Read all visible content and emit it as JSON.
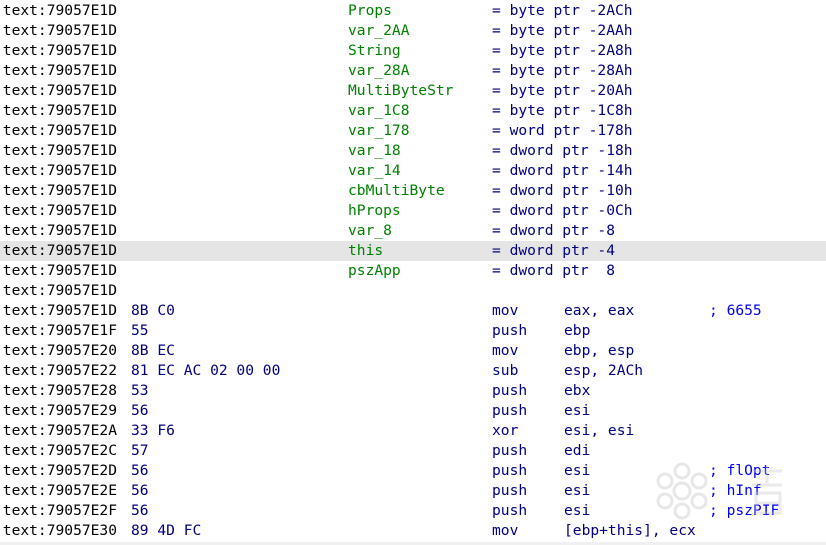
{
  "disasm": {
    "lines": [
      {
        "addr": ".text:79057E1D",
        "bytes": "",
        "name": "Props",
        "mnem": "= byte ptr -2ACh",
        "ops": "",
        "comment": ""
      },
      {
        "addr": ".text:79057E1D",
        "bytes": "",
        "name": "var_2AA",
        "mnem": "= byte ptr -2AAh",
        "ops": "",
        "comment": ""
      },
      {
        "addr": ".text:79057E1D",
        "bytes": "",
        "name": "String",
        "mnem": "= byte ptr -2A8h",
        "ops": "",
        "comment": ""
      },
      {
        "addr": ".text:79057E1D",
        "bytes": "",
        "name": "var_28A",
        "mnem": "= byte ptr -28Ah",
        "ops": "",
        "comment": ""
      },
      {
        "addr": ".text:79057E1D",
        "bytes": "",
        "name": "MultiByteStr",
        "mnem": "= byte ptr -20Ah",
        "ops": "",
        "comment": ""
      },
      {
        "addr": ".text:79057E1D",
        "bytes": "",
        "name": "var_1C8",
        "mnem": "= byte ptr -1C8h",
        "ops": "",
        "comment": ""
      },
      {
        "addr": ".text:79057E1D",
        "bytes": "",
        "name": "var_178",
        "mnem": "= word ptr -178h",
        "ops": "",
        "comment": ""
      },
      {
        "addr": ".text:79057E1D",
        "bytes": "",
        "name": "var_18",
        "mnem": "= dword ptr -18h",
        "ops": "",
        "comment": ""
      },
      {
        "addr": ".text:79057E1D",
        "bytes": "",
        "name": "var_14",
        "mnem": "= dword ptr -14h",
        "ops": "",
        "comment": ""
      },
      {
        "addr": ".text:79057E1D",
        "bytes": "",
        "name": "cbMultiByte",
        "mnem": "= dword ptr -10h",
        "ops": "",
        "comment": ""
      },
      {
        "addr": ".text:79057E1D",
        "bytes": "",
        "name": "hProps",
        "mnem": "= dword ptr -0Ch",
        "ops": "",
        "comment": ""
      },
      {
        "addr": ".text:79057E1D",
        "bytes": "",
        "name": "var_8",
        "mnem": "= dword ptr -8",
        "ops": "",
        "comment": ""
      },
      {
        "addr": ".text:79057E1D",
        "bytes": "",
        "name": "this",
        "mnem": "= dword ptr -4",
        "ops": "",
        "comment": "",
        "highlight": true
      },
      {
        "addr": ".text:79057E1D",
        "bytes": "",
        "name": "pszApp",
        "mnem": "= dword ptr  8",
        "ops": "",
        "comment": ""
      },
      {
        "addr": ".text:79057E1D",
        "bytes": "",
        "name": "",
        "mnem": "",
        "ops": "",
        "comment": ""
      },
      {
        "addr": ".text:79057E1D",
        "bytes": "8B C0",
        "name": "",
        "mnem": "mov",
        "ops": "eax, eax",
        "comment": "; 6655"
      },
      {
        "addr": ".text:79057E1F",
        "bytes": "55",
        "name": "",
        "mnem": "push",
        "ops": "ebp",
        "comment": ""
      },
      {
        "addr": ".text:79057E20",
        "bytes": "8B EC",
        "name": "",
        "mnem": "mov",
        "ops": "ebp, esp",
        "comment": ""
      },
      {
        "addr": ".text:79057E22",
        "bytes": "81 EC AC 02 00 00",
        "name": "",
        "mnem": "sub",
        "ops": "esp, 2ACh",
        "comment": ""
      },
      {
        "addr": ".text:79057E28",
        "bytes": "53",
        "name": "",
        "mnem": "push",
        "ops": "ebx",
        "comment": ""
      },
      {
        "addr": ".text:79057E29",
        "bytes": "56",
        "name": "",
        "mnem": "push",
        "ops": "esi",
        "comment": ""
      },
      {
        "addr": ".text:79057E2A",
        "bytes": "33 F6",
        "name": "",
        "mnem": "xor",
        "ops": "esi, esi",
        "comment": ""
      },
      {
        "addr": ".text:79057E2C",
        "bytes": "57",
        "name": "",
        "mnem": "push",
        "ops": "edi",
        "comment": ""
      },
      {
        "addr": ".text:79057E2D",
        "bytes": "56",
        "name": "",
        "mnem": "push",
        "ops": "esi",
        "comment": "; flOpt"
      },
      {
        "addr": ".text:79057E2E",
        "bytes": "56",
        "name": "",
        "mnem": "push",
        "ops": "esi",
        "comment": "; hInf"
      },
      {
        "addr": ".text:79057E2F",
        "bytes": "56",
        "name": "",
        "mnem": "push",
        "ops": "esi",
        "comment": "; pszPIF"
      },
      {
        "addr": ".text:79057E30",
        "bytes": "89 4D FC",
        "name": "",
        "mnem": "mov",
        "ops": "[ebp+this], ecx",
        "comment": ""
      }
    ]
  },
  "colors": {
    "address": "#000000",
    "bytes": "#000080",
    "names": "#008000",
    "instructions": "#000080",
    "comments": "#0000ff",
    "highlight": "#e5e5e5"
  },
  "watermark": {
    "icon": "snowflake-logo-icon"
  }
}
